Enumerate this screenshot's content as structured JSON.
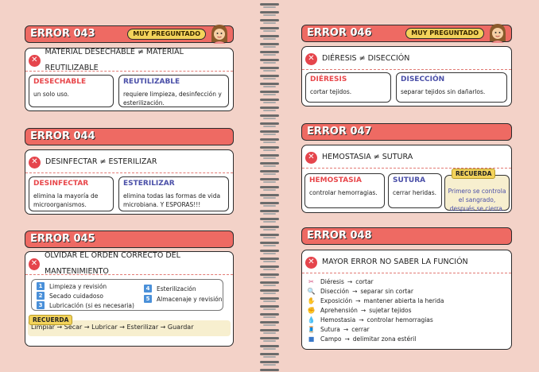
{
  "badge_label": "MUY PREGUNTADO",
  "arrow": "→",
  "left": {
    "e43": {
      "header": "ERROR 043",
      "title": "MATERIAL DESECHABLE ≠ MATERIAL REUTILIZABLE",
      "a": {
        "term": "DESECHABLE",
        "desc": "un solo uso."
      },
      "b": {
        "term": "REUTILIZABLE",
        "desc": "requiere limpieza, desinfección y esterilización."
      }
    },
    "e44": {
      "header": "ERROR 044",
      "title": "DESINFECTAR ≠ ESTERILIZAR",
      "a": {
        "term": "DESINFECTAR",
        "desc": "elimina la mayoría de microorganismos."
      },
      "b": {
        "term": "ESTERILIZAR",
        "desc": "elimina todas las formas de vida microbiana. Y ESPORAS!!!"
      }
    },
    "e45": {
      "header": "ERROR 045",
      "title": "OLVIDAR EL ORDEN CORRECTO DEL MANTENIMIENTO",
      "steps": [
        {
          "n": "1",
          "label": "Limpieza y revisión"
        },
        {
          "n": "2",
          "label": "Secado cuidadoso"
        },
        {
          "n": "3",
          "label": "Lubricación (si es necesaria)"
        },
        {
          "n": "4",
          "label": "Esterilización"
        },
        {
          "n": "5",
          "label": "Almacenaje y revisión"
        }
      ],
      "recuerda": "RECUERDA",
      "flow": "Limpiar → Secar → Lubricar → Esterilizar → Guardar"
    }
  },
  "right": {
    "e46": {
      "header": "ERROR 046",
      "title": "DIÉRESIS ≠ DISECCIÓN",
      "a": {
        "term": "DIÉRESIS",
        "desc": "cortar tejidos."
      },
      "b": {
        "term": "DISECCIÓN",
        "desc": "separar tejidos sin dañarlos."
      }
    },
    "e47": {
      "header": "ERROR 047",
      "title": "HEMOSTASIA ≠ SUTURA",
      "a": {
        "term": "HEMOSTASIA",
        "desc": "controlar hemorragias."
      },
      "b": {
        "term": "SUTURA",
        "desc": "cerrar heridas."
      },
      "recuerda": "RECUERDA",
      "note": "Primero se controla el sangrado, después se cierra."
    },
    "e48": {
      "header": "ERROR 048",
      "title": "MAYOR ERROR NO SABER LA FUNCIÓN",
      "items": [
        {
          "icon": "scissors-icon",
          "glyph": "✂",
          "color": "#d14b7a",
          "name": "Diéresis",
          "fn": "cortar"
        },
        {
          "icon": "magnifier-icon",
          "glyph": "🔍",
          "color": "#3a78c9",
          "name": "Disección",
          "fn": "separar sin cortar"
        },
        {
          "icon": "hand-icon",
          "glyph": "✋",
          "color": "#e8a23c",
          "name": "Exposición",
          "fn": "mantener abierta la herida"
        },
        {
          "icon": "grab-icon",
          "glyph": "✊",
          "color": "#e8a23c",
          "name": "Aprehensión",
          "fn": "sujetar tejidos"
        },
        {
          "icon": "drop-icon",
          "glyph": "💧",
          "color": "#d9363e",
          "name": "Hemostasia",
          "fn": "controlar hemorragias"
        },
        {
          "icon": "needle-icon",
          "glyph": "🧵",
          "color": "#8a6ad1",
          "name": "Sutura",
          "fn": "cerrar"
        },
        {
          "icon": "square-icon",
          "glyph": "■",
          "color": "#3a78c9",
          "name": "Campo",
          "fn": "delimitar zona estéril"
        }
      ]
    }
  }
}
